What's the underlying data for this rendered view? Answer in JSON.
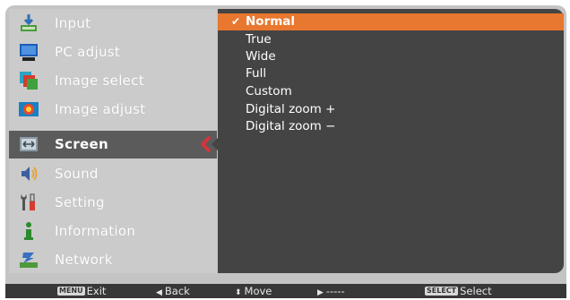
{
  "sidebar": {
    "items": [
      {
        "label": "Input",
        "icon": "input-icon"
      },
      {
        "label": "PC adjust",
        "icon": "pc-adjust-icon"
      },
      {
        "label": "Image select",
        "icon": "image-select-icon"
      },
      {
        "label": "Image adjust",
        "icon": "image-adjust-icon"
      },
      {
        "label": "Screen",
        "icon": "screen-icon",
        "active": true
      },
      {
        "label": "Sound",
        "icon": "sound-icon"
      },
      {
        "label": "Setting",
        "icon": "setting-icon"
      },
      {
        "label": "Information",
        "icon": "information-icon"
      },
      {
        "label": "Network",
        "icon": "network-icon"
      }
    ]
  },
  "screen_menu": {
    "options": [
      {
        "label": "Normal",
        "selected": true
      },
      {
        "label": "True"
      },
      {
        "label": "Wide"
      },
      {
        "label": "Full"
      },
      {
        "label": "Custom"
      },
      {
        "label": "Digital zoom +"
      },
      {
        "label": "Digital zoom −"
      }
    ],
    "check_glyph": "✔"
  },
  "statusbar": {
    "exit": {
      "key": "MENU",
      "label": "Exit"
    },
    "back": {
      "glyph": "◀",
      "label": "Back"
    },
    "move": {
      "glyph": "⬍",
      "label": "Move"
    },
    "next": {
      "glyph": "▶",
      "label": "-----"
    },
    "select": {
      "key": "SELECT",
      "label": "Select"
    }
  },
  "colors": {
    "accent": "#e8772f",
    "active_arrow": "#e0303a",
    "panel": "#444444",
    "sidebar": "#cbcbcb"
  }
}
